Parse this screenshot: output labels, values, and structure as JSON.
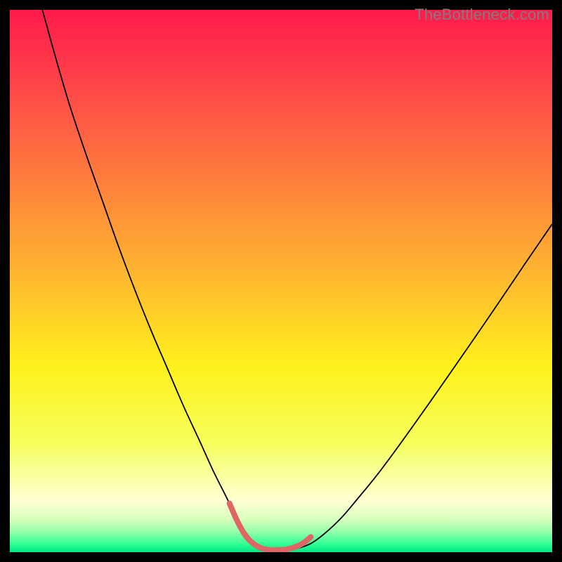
{
  "watermark": "TheBottleneck.com",
  "chart_data": {
    "type": "line",
    "title": "",
    "xlabel": "",
    "ylabel": "",
    "xlim": [
      0,
      100
    ],
    "ylim": [
      0,
      100
    ],
    "background_gradient": {
      "stops": [
        {
          "offset": 0.0,
          "color": "#ff1a4b"
        },
        {
          "offset": 0.12,
          "color": "#ff3f4a"
        },
        {
          "offset": 0.3,
          "color": "#ff7a3d"
        },
        {
          "offset": 0.48,
          "color": "#ffb431"
        },
        {
          "offset": 0.66,
          "color": "#fff11c"
        },
        {
          "offset": 0.8,
          "color": "#f6ff5e"
        },
        {
          "offset": 0.905,
          "color": "#ffffd2"
        },
        {
          "offset": 0.94,
          "color": "#d7ffbc"
        },
        {
          "offset": 0.965,
          "color": "#8bffa8"
        },
        {
          "offset": 0.985,
          "color": "#2fff95"
        },
        {
          "offset": 1.0,
          "color": "#00e884"
        }
      ]
    },
    "series": [
      {
        "name": "bottleneck-curve",
        "color": "#000000",
        "width": 1.8,
        "x": [
          6.0,
          8.5,
          11.0,
          14.0,
          17.0,
          20.0,
          23.0,
          26.0,
          29.0,
          32.0,
          35.0,
          37.5,
          40.0,
          42.0,
          44.0,
          45.5,
          47.0,
          49.0,
          51.0,
          53.0,
          55.5,
          58.0,
          61.0,
          64.0,
          68.0,
          72.0,
          76.0,
          80.0,
          85.0,
          90.0,
          95.0,
          100.0
        ],
        "y": [
          100.0,
          91.0,
          82.5,
          73.5,
          65.0,
          56.5,
          48.5,
          41.0,
          34.0,
          27.0,
          20.5,
          15.0,
          10.0,
          6.0,
          3.0,
          1.3,
          0.6,
          0.4,
          0.4,
          0.7,
          1.6,
          3.4,
          6.2,
          9.7,
          14.6,
          20.0,
          25.6,
          31.3,
          38.5,
          45.8,
          53.2,
          60.5
        ]
      },
      {
        "name": "highlight-segment",
        "color": "#e06666",
        "width": 8,
        "linecap": "round",
        "x": [
          40.5,
          42.0,
          43.5,
          45.0,
          46.5,
          48.0,
          49.5,
          51.0,
          52.5,
          54.0,
          55.5
        ],
        "y": [
          9.0,
          5.6,
          3.0,
          1.5,
          0.7,
          0.4,
          0.4,
          0.5,
          0.9,
          1.6,
          2.8
        ]
      }
    ]
  }
}
